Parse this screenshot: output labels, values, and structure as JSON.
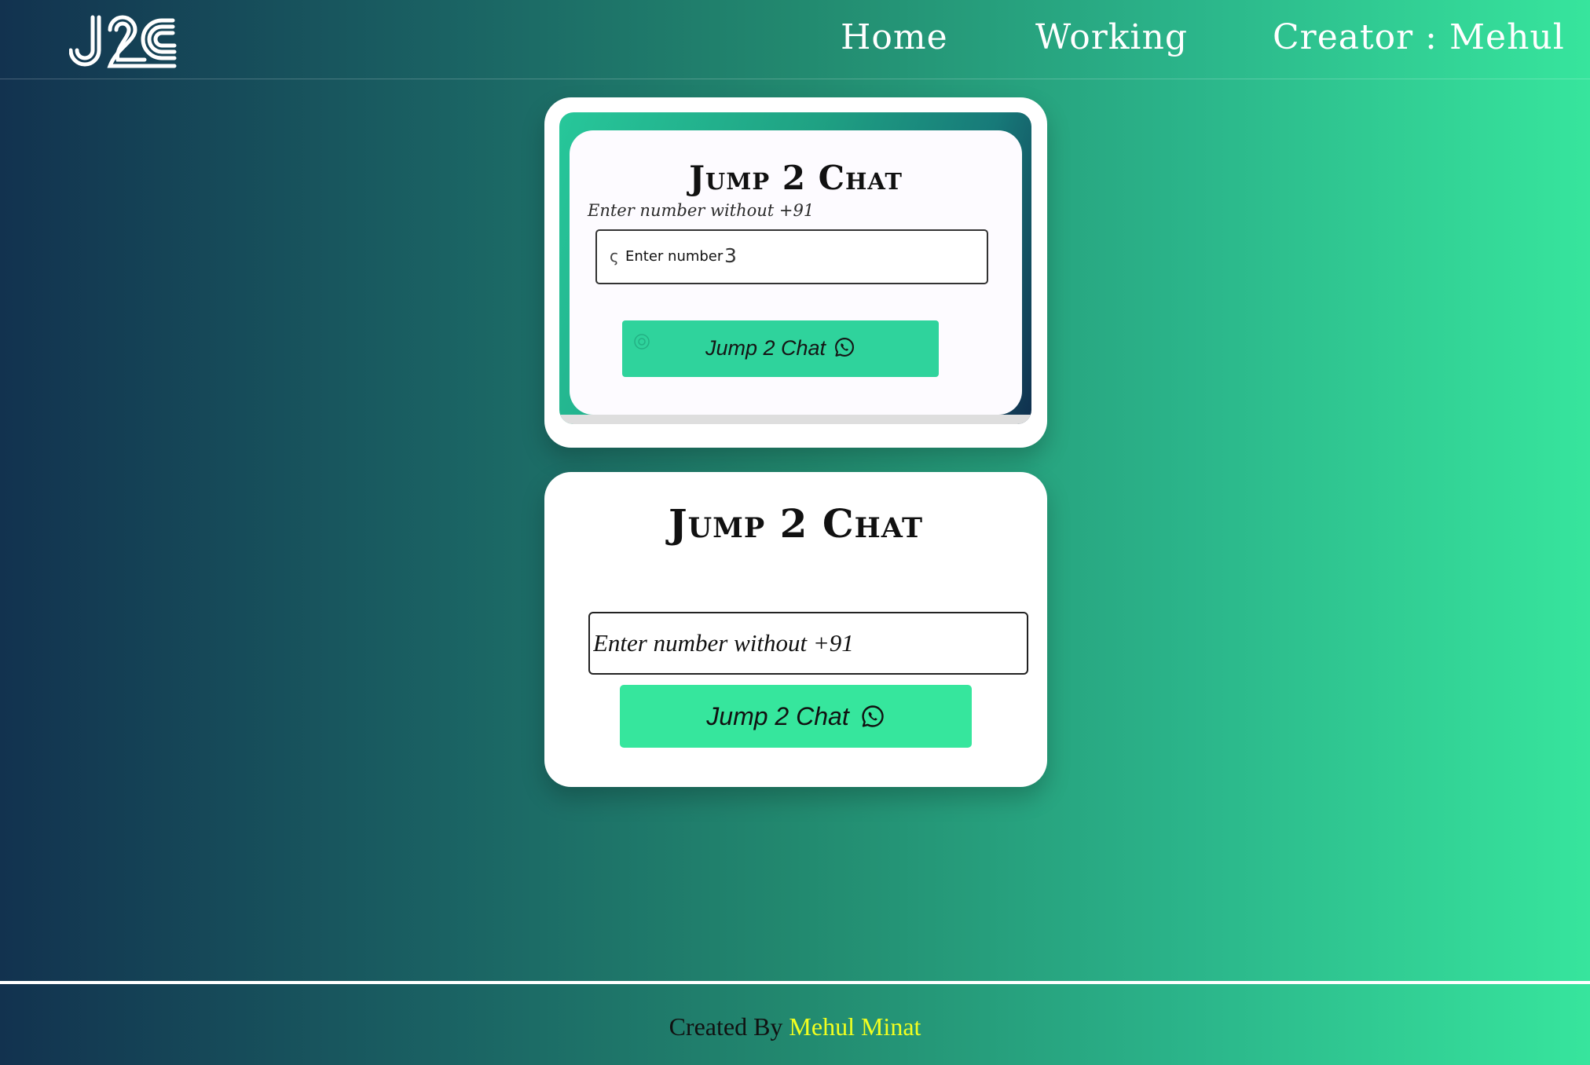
{
  "header": {
    "logo_text": "J2C",
    "nav": {
      "home": "Home",
      "working": "Working",
      "creator": "Creator : Mehul"
    }
  },
  "preview_card": {
    "title": "Jump 2 Chat",
    "hint": "Enter number without +91",
    "input_label": "Enter number",
    "input_value": "3",
    "button_label": "Jump 2 Chat",
    "button_icon": "whatsapp-icon"
  },
  "form_card": {
    "title": "Jump 2 Chat",
    "input_placeholder": "Enter number without +91",
    "input_value": "",
    "button_label": "Jump 2 Chat",
    "button_icon": "whatsapp-icon"
  },
  "footer": {
    "prefix": "Created By",
    "name": "Mehul Minat"
  },
  "colors": {
    "gradient_start": "#12324f",
    "gradient_end": "#37e59d",
    "button_green": "#36e69d",
    "footer_name": "#f2ff1f"
  }
}
